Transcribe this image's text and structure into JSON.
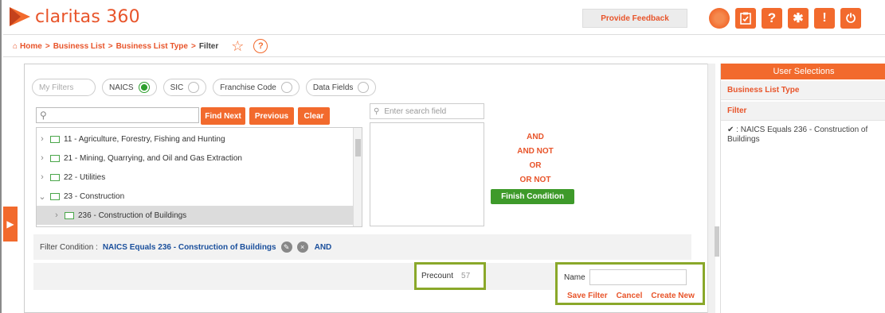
{
  "app": {
    "name": "claritas 360"
  },
  "header": {
    "feedback_label": "Provide Feedback",
    "icons": [
      "globe-icon",
      "clipboard-icon",
      "help-icon",
      "settings-icon",
      "info-icon",
      "power-icon"
    ],
    "accent": "#f26a2d"
  },
  "breadcrumb": {
    "items": [
      "Home",
      "Business List",
      "Business List Type",
      "Filter"
    ],
    "separator": ">",
    "icons": [
      "home-icon",
      "star-icon",
      "help-bubble-icon"
    ]
  },
  "filter_types": {
    "search_placeholder": "My Filters",
    "options": [
      {
        "label": "NAICS",
        "selected": true
      },
      {
        "label": "SIC",
        "selected": false
      },
      {
        "label": "Franchise Code",
        "selected": false
      },
      {
        "label": "Data Fields",
        "selected": false
      }
    ]
  },
  "tree_toolbar": {
    "find_next": "Find Next",
    "previous": "Previous",
    "clear": "Clear"
  },
  "tree": {
    "rows": [
      {
        "label": "11 - Agriculture, Forestry, Fishing and Hunting",
        "expanded": false,
        "selected": false,
        "level": 0
      },
      {
        "label": "21 - Mining, Quarrying, and Oil and Gas Extraction",
        "expanded": false,
        "selected": false,
        "level": 0
      },
      {
        "label": "22 - Utilities",
        "expanded": false,
        "selected": false,
        "level": 0
      },
      {
        "label": "23 - Construction",
        "expanded": true,
        "selected": false,
        "level": 0
      },
      {
        "label": "236 - Construction of Buildings",
        "expanded": false,
        "selected": true,
        "level": 1
      }
    ]
  },
  "field_search": {
    "placeholder": "Enter search field"
  },
  "operators": [
    "AND",
    "AND NOT",
    "OR",
    "OR NOT"
  ],
  "finish_label": "Finish Condition",
  "condition": {
    "label": "Filter Condition :",
    "value": "NAICS Equals 236 - Construction of Buildings",
    "joiner": "AND"
  },
  "precount": {
    "label": "Precount",
    "value": "57"
  },
  "save": {
    "name_label": "Name",
    "links": [
      "Save Filter",
      "Cancel",
      "Create New"
    ]
  },
  "user_selections": {
    "title": "User Selections",
    "sections": [
      "Business List Type",
      "Filter"
    ],
    "filter_item": ": NAICS Equals 236 - Construction of Buildings"
  },
  "colors": {
    "brand": "#e8542a",
    "highlight_border": "#8aa82a",
    "finish_green": "#3e9a2a",
    "link_blue": "#1a4f9c"
  }
}
